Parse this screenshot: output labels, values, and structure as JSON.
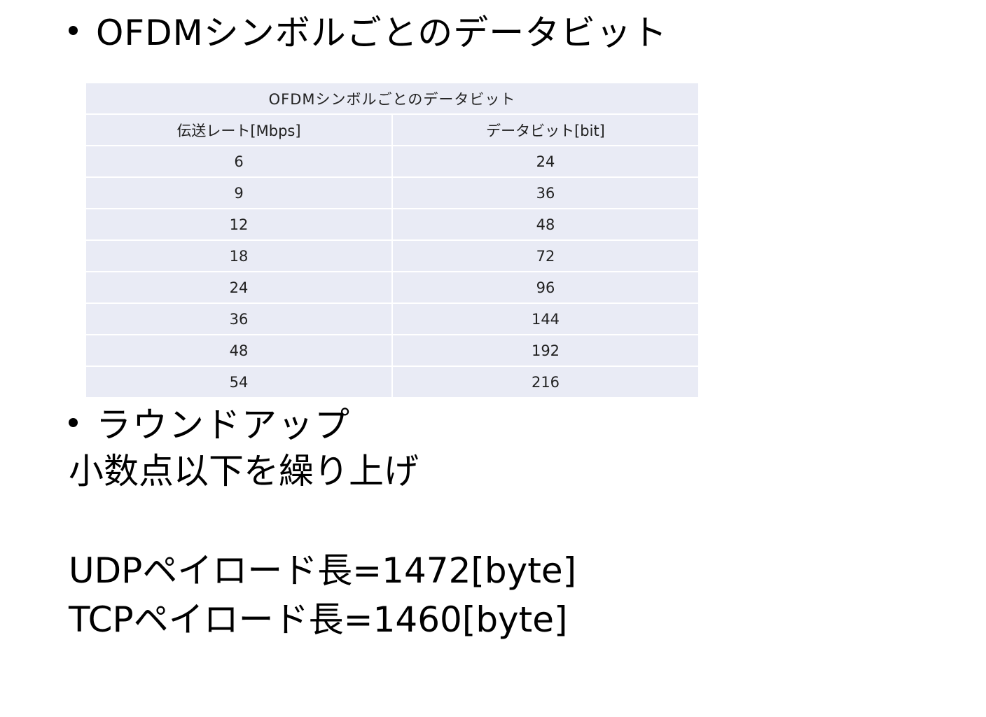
{
  "heading_bullet": "OFDMシンボルごとのデータビット",
  "table": {
    "caption": "OFDMシンボルごとのデータビット",
    "columns": [
      "伝送レート[Mbps]",
      "データビット[bit]"
    ],
    "rows": [
      [
        "6",
        "24"
      ],
      [
        "9",
        "36"
      ],
      [
        "12",
        "48"
      ],
      [
        "18",
        "72"
      ],
      [
        "24",
        "96"
      ],
      [
        "36",
        "144"
      ],
      [
        "48",
        "192"
      ],
      [
        "54",
        "216"
      ]
    ]
  },
  "roundup_bullet": "ラウンドアップ",
  "roundup_description": "小数点以下を繰り上げ",
  "udp_payload": "UDPペイロード長=1472[byte]",
  "tcp_payload": "TCPペイロード長=1460[byte]"
}
